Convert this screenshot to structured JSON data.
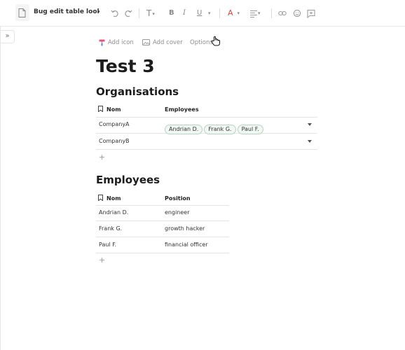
{
  "toolbar": {
    "doc_title": "Bug edit table lookup",
    "icons": [
      "file-icon",
      "undo-icon",
      "redo-icon",
      "text-type-icon",
      "bold-icon",
      "italic-icon",
      "underline-icon",
      "text-color-icon",
      "align-icon",
      "link-icon",
      "emoji-icon",
      "comment-icon"
    ],
    "bold_glyph": "B",
    "italic_glyph": "I",
    "underline_glyph": "U",
    "text_type_glyph": "T",
    "color_glyph": "A",
    "text_color_hex": "#e0453b"
  },
  "sidebar": {
    "collapse_glyph": "»"
  },
  "page": {
    "add_icon_label": "Add icon",
    "add_cover_label": "Add cover",
    "options_label": "Options",
    "title": "Test 3"
  },
  "organisations": {
    "heading": "Organisations",
    "columns": [
      "Nom",
      "Employees"
    ],
    "rows": [
      {
        "nom": "CompanyA",
        "employees": [
          "Andrian D.",
          "Frank G.",
          "Paul F."
        ]
      },
      {
        "nom": "CompanyB",
        "employees": []
      }
    ],
    "add_glyph": "+"
  },
  "employees": {
    "heading": "Employees",
    "columns": [
      "Nom",
      "Position"
    ],
    "rows": [
      {
        "nom": "Andrian D.",
        "position": "engineer"
      },
      {
        "nom": "Frank G.",
        "position": "growth hacker"
      },
      {
        "nom": "Paul F.",
        "position": "financial officer"
      }
    ],
    "add_glyph": "+"
  },
  "colors": {
    "chip_border": "#b7d3c6",
    "chip_bg": "#f1f8f4",
    "icon_grey": "#8a8a8a"
  }
}
